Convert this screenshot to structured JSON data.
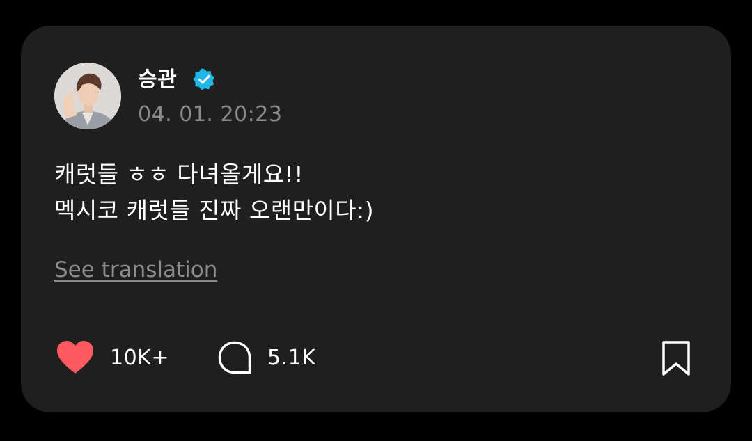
{
  "post": {
    "author": {
      "name": "승관",
      "verified": true
    },
    "timestamp": "04. 01. 20:23",
    "text_lines": [
      "캐럿들 ㅎㅎ 다녀올게요!!",
      "멕시코 캐럿들 진짜 오랜만이다:)"
    ],
    "see_translation_label": "See translation"
  },
  "actions": {
    "likes": "10K+",
    "comments": "5.1K"
  },
  "colors": {
    "card_background": "#1f1f1f",
    "page_background": "#000000",
    "like_heart": "#ff5a5f",
    "verified_badge": "#1fb6e8",
    "muted_text": "#8a8a8a"
  },
  "icons": {
    "like": "heart-icon",
    "comment": "comment-bubble-icon",
    "bookmark": "bookmark-icon",
    "verified": "verified-badge-icon"
  }
}
